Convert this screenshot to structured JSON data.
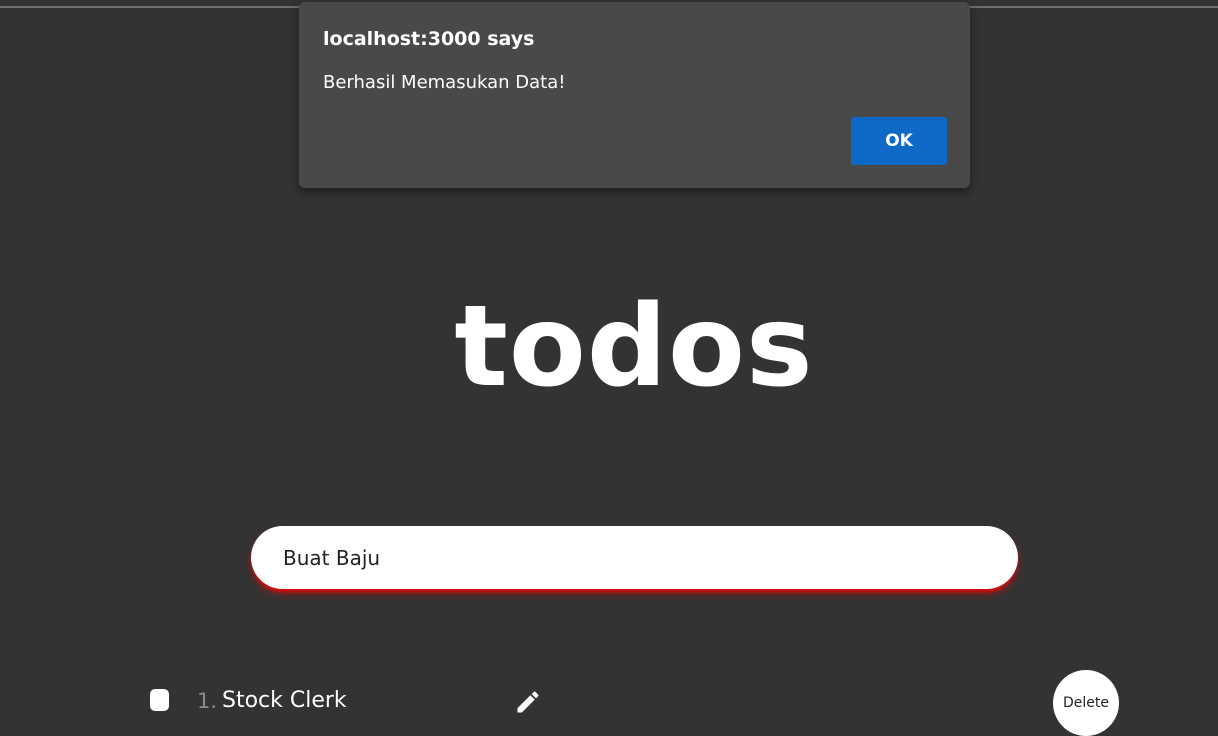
{
  "alert": {
    "title": "localhost:3000 says",
    "message": "Berhasil Memasukan Data!",
    "ok_label": "OK"
  },
  "app": {
    "title": "todos"
  },
  "input": {
    "value": "Buat Baju"
  },
  "todos": [
    {
      "number": "1.",
      "text": "Stock Clerk",
      "delete_label": "Delete",
      "edit_icon": "pencil-icon"
    }
  ],
  "colors": {
    "background": "#333333",
    "dialog": "#494949",
    "ok_button": "#0e6ac6",
    "input_glow": "#d10d0d"
  }
}
